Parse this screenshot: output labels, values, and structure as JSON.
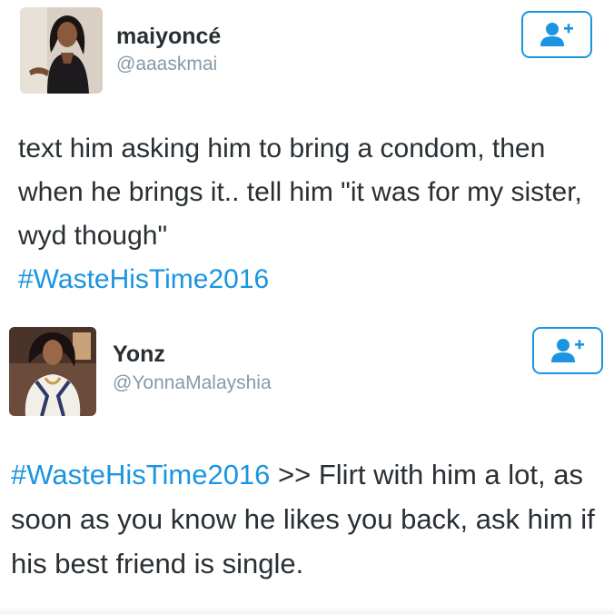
{
  "tweets": [
    {
      "display_name": "maiyoncé",
      "handle": "@aaaskmai",
      "avatar_icon": "profile-photo",
      "follow_icon": "add-user-icon",
      "text": {
        "body": "text him asking him to bring a condom, then when he brings it.. tell him \"it was for my sister, wyd though\"",
        "hashtag": "#WasteHisTime2016"
      }
    },
    {
      "display_name": "Yonz",
      "handle": "@YonnaMalayshia",
      "avatar_icon": "profile-photo",
      "follow_icon": "add-user-icon",
      "text": {
        "hashtag": "#WasteHisTime2016",
        "body": " >> Flirt with him a lot, as soon as you know he likes you back, ask him if his best friend is single."
      }
    }
  ],
  "colors": {
    "link": "#1b95e0",
    "text": "#292f33",
    "secondary": "#8899a6"
  }
}
